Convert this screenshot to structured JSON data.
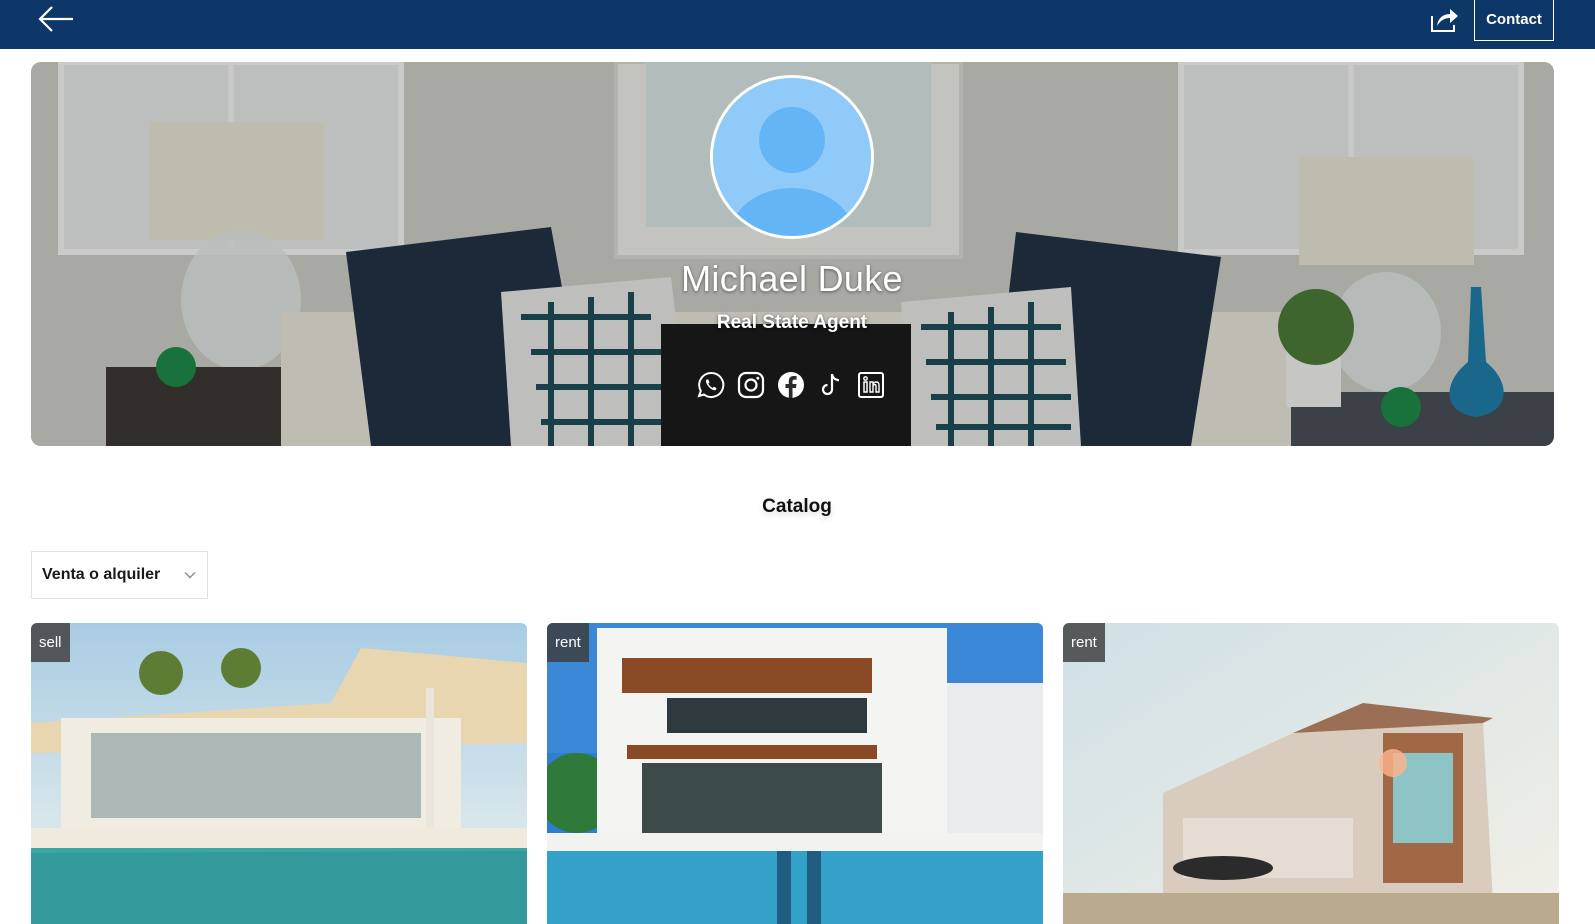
{
  "header": {
    "back_icon": "arrow-left-icon",
    "share_icon": "share-icon",
    "contact_label": "Contact",
    "bar_color": "#0e3769"
  },
  "profile": {
    "name": "Michael Duke",
    "role": "Real State Agent",
    "avatar_color": "#90caf9",
    "socials": [
      {
        "network": "whatsapp",
        "icon": "whatsapp-icon"
      },
      {
        "network": "instagram",
        "icon": "instagram-icon"
      },
      {
        "network": "facebook",
        "icon": "facebook-icon"
      },
      {
        "network": "tiktok",
        "icon": "tiktok-icon"
      },
      {
        "network": "linkedin",
        "icon": "linkedin-icon"
      }
    ]
  },
  "catalog": {
    "title": "Catalog",
    "filter": {
      "selected": "Venta o alquiler",
      "icon": "chevron-down-icon"
    },
    "listings": [
      {
        "badge": "sell"
      },
      {
        "badge": "rent"
      },
      {
        "badge": "rent"
      }
    ]
  }
}
